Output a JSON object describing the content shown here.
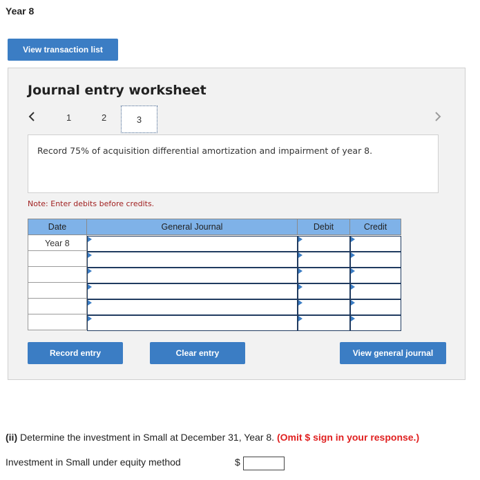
{
  "heading": "Year 8",
  "view_transaction_list_label": "View transaction list",
  "worksheet": {
    "title": "Journal entry worksheet",
    "prev_icon": "chevron-left-icon",
    "next_icon": "chevron-right-icon",
    "pages": [
      "1",
      "2",
      "3"
    ],
    "current_page": "3",
    "instruction": "Record 75% of acquisition differential amortization and impairment of year 8.",
    "note": "Note: Enter debits before credits.",
    "table": {
      "headers": {
        "date": "Date",
        "journal": "General Journal",
        "debit": "Debit",
        "credit": "Credit"
      },
      "rows": [
        {
          "date": "Year 8",
          "account": "",
          "debit": "",
          "credit": ""
        },
        {
          "date": "",
          "account": "",
          "debit": "",
          "credit": ""
        },
        {
          "date": "",
          "account": "",
          "debit": "",
          "credit": ""
        },
        {
          "date": "",
          "account": "",
          "debit": "",
          "credit": ""
        },
        {
          "date": "",
          "account": "",
          "debit": "",
          "credit": ""
        },
        {
          "date": "",
          "account": "",
          "debit": "",
          "credit": ""
        }
      ]
    },
    "record_entry_label": "Record entry",
    "clear_entry_label": "Clear entry",
    "view_general_journal_label": "View general journal"
  },
  "question": {
    "label": "(ii)",
    "text": " Determine the investment in Small at December 31, Year 8. ",
    "omit_note": "(Omit $ sign in your response.)"
  },
  "investment": {
    "label": "Investment in Small under equity method",
    "currency": "$",
    "value": ""
  },
  "colors": {
    "accent": "#3b7dc4",
    "header_bg": "#7fb2e8",
    "note": "#a01f1f",
    "emphasis": "#e02020"
  }
}
